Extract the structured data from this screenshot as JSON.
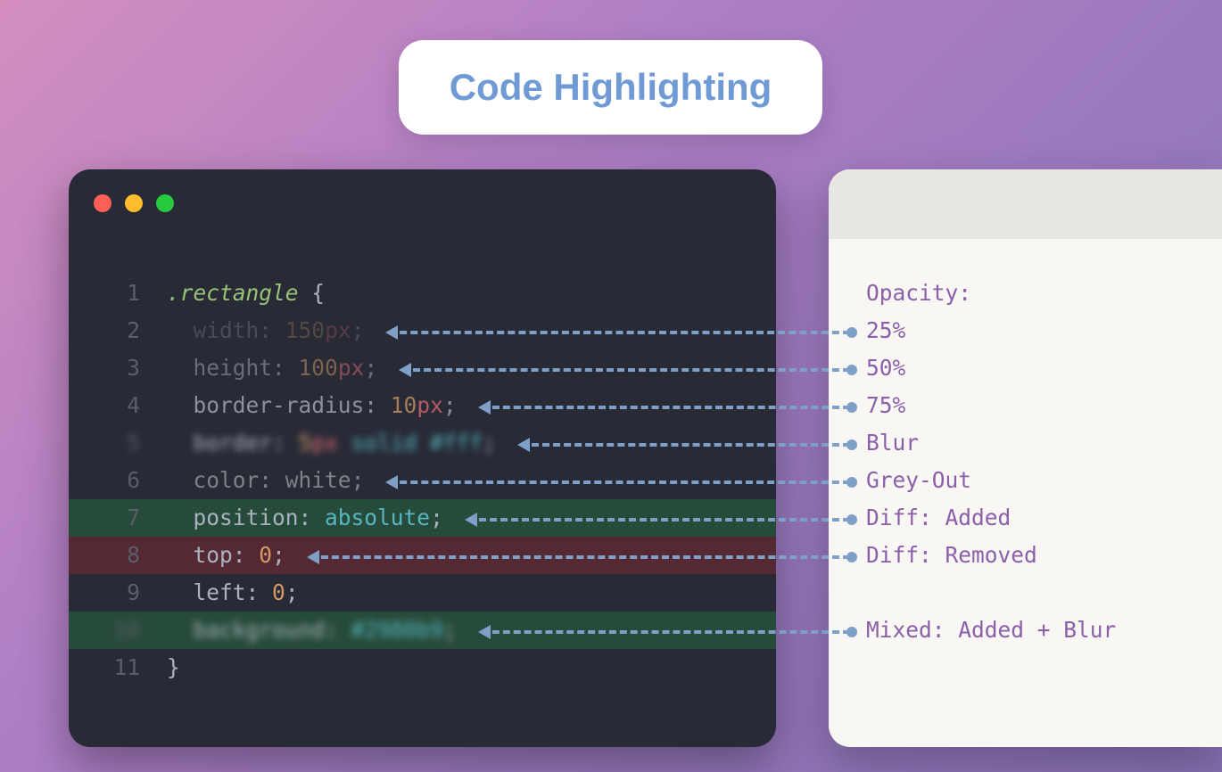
{
  "title": "Code Highlighting",
  "code": {
    "lines": [
      {
        "n": "1",
        "tokens": [
          [
            ".rectangle",
            "sel"
          ],
          [
            " ",
            ""
          ],
          [
            "{",
            "punc"
          ]
        ],
        "effects": []
      },
      {
        "n": "2",
        "tokens": [
          [
            "  ",
            ""
          ],
          [
            "width",
            "prop"
          ],
          [
            ": ",
            "punc"
          ],
          [
            "150",
            "num"
          ],
          [
            "px",
            "unit"
          ],
          [
            ";",
            "punc"
          ]
        ],
        "effects": [
          "op25"
        ]
      },
      {
        "n": "3",
        "tokens": [
          [
            "  ",
            ""
          ],
          [
            "height",
            "prop"
          ],
          [
            ": ",
            "punc"
          ],
          [
            "100",
            "num"
          ],
          [
            "px",
            "unit"
          ],
          [
            ";",
            "punc"
          ]
        ],
        "effects": [
          "op50"
        ]
      },
      {
        "n": "4",
        "tokens": [
          [
            "  ",
            ""
          ],
          [
            "border-radius",
            "prop"
          ],
          [
            ": ",
            "punc"
          ],
          [
            "10",
            "num"
          ],
          [
            "px",
            "unit"
          ],
          [
            ";",
            "punc"
          ]
        ],
        "effects": [
          "op75"
        ]
      },
      {
        "n": "5",
        "tokens": [
          [
            "  ",
            ""
          ],
          [
            "border",
            "prop"
          ],
          [
            ": ",
            "punc"
          ],
          [
            "5",
            "num"
          ],
          [
            "px",
            "unit"
          ],
          [
            " ",
            ""
          ],
          [
            "solid",
            "val"
          ],
          [
            " ",
            ""
          ],
          [
            "#fff",
            "hex"
          ],
          [
            ";",
            "punc"
          ]
        ],
        "effects": [
          "blur"
        ]
      },
      {
        "n": "6",
        "tokens": [
          [
            "  ",
            ""
          ],
          [
            "color",
            "prop"
          ],
          [
            ": ",
            "punc"
          ],
          [
            "white",
            "val"
          ],
          [
            ";",
            "punc"
          ]
        ],
        "effects": [
          "greyout"
        ]
      },
      {
        "n": "7",
        "tokens": [
          [
            "  ",
            ""
          ],
          [
            "position",
            "prop"
          ],
          [
            ": ",
            "punc"
          ],
          [
            "absolute",
            "val"
          ],
          [
            ";",
            "punc"
          ]
        ],
        "effects": [
          "added"
        ]
      },
      {
        "n": "8",
        "tokens": [
          [
            "  ",
            ""
          ],
          [
            "top",
            "prop"
          ],
          [
            ": ",
            "punc"
          ],
          [
            "0",
            "num"
          ],
          [
            ";",
            "punc"
          ]
        ],
        "effects": [
          "removed"
        ]
      },
      {
        "n": "9",
        "tokens": [
          [
            "  ",
            ""
          ],
          [
            "left",
            "prop"
          ],
          [
            ": ",
            "punc"
          ],
          [
            "0",
            "num"
          ],
          [
            ";",
            "punc"
          ]
        ],
        "effects": []
      },
      {
        "n": "10",
        "tokens": [
          [
            "  ",
            ""
          ],
          [
            "background",
            "prop"
          ],
          [
            ": ",
            "punc"
          ],
          [
            "#2980b9",
            "hex"
          ],
          [
            ";",
            "punc"
          ]
        ],
        "effects": [
          "added",
          "blur"
        ]
      },
      {
        "n": "11",
        "tokens": [
          [
            "}",
            "punc"
          ]
        ],
        "effects": []
      }
    ]
  },
  "notes": {
    "header": "Opacity:",
    "items": [
      {
        "label": "25%",
        "line": 2
      },
      {
        "label": "50%",
        "line": 3
      },
      {
        "label": "75%",
        "line": 4
      },
      {
        "label": "Blur",
        "line": 5
      },
      {
        "label": "Grey-Out",
        "line": 6
      },
      {
        "label": "Diff: Added",
        "line": 7
      },
      {
        "label": "Diff: Removed",
        "line": 8
      },
      {
        "label": "Mixed: Added + Blur",
        "line": 10
      }
    ]
  },
  "colors": {
    "arrow": "#7ea0c8",
    "accent": "#6f9ad6",
    "note_text": "#8b5fa9"
  }
}
